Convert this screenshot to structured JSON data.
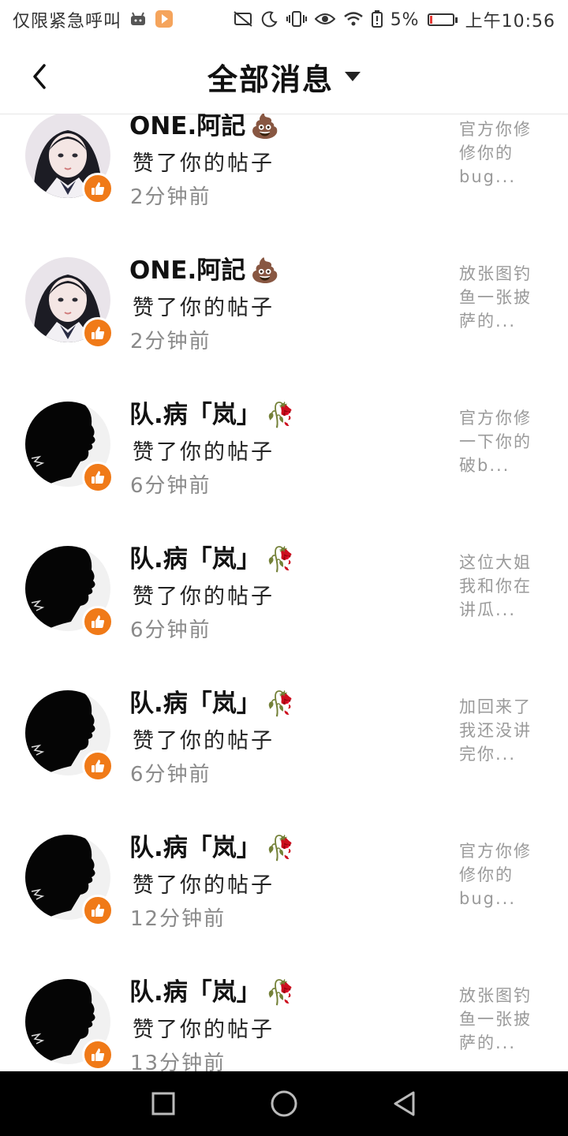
{
  "status_bar": {
    "left_text": "仅限紧急呼叫",
    "battery": "5%",
    "time": "上午10:56",
    "icons": [
      "android-debug-icon",
      "video-app-icon",
      "no-sim-icon",
      "moon-icon",
      "vibrate-icon",
      "eye-icon",
      "wifi-icon",
      "battery-saver-icon",
      "battery-icon"
    ]
  },
  "header": {
    "title": "全部消息",
    "back_icon": "chevron-left-icon",
    "dropdown_icon": "caret-down-icon"
  },
  "notifications": [
    {
      "name": "ONE.阿記",
      "emoji": "💩",
      "action": "赞了你的帖子",
      "time": "2分钟前",
      "preview": "官方你修修你的bug...",
      "avatar": "girl"
    },
    {
      "name": "ONE.阿記",
      "emoji": "💩",
      "action": "赞了你的帖子",
      "time": "2分钟前",
      "preview": "放张图钓鱼一张披萨的...",
      "avatar": "girl"
    },
    {
      "name": "队.病「岚」",
      "emoji": "🥀",
      "action": "赞了你的帖子",
      "time": "6分钟前",
      "preview": "官方你修一下你的破b...",
      "avatar": "silhouette"
    },
    {
      "name": "队.病「岚」",
      "emoji": "🥀",
      "action": "赞了你的帖子",
      "time": "6分钟前",
      "preview": "这位大姐我和你在讲瓜...",
      "avatar": "silhouette"
    },
    {
      "name": "队.病「岚」",
      "emoji": "🥀",
      "action": "赞了你的帖子",
      "time": "6分钟前",
      "preview": "加回来了我还没讲完你...",
      "avatar": "silhouette"
    },
    {
      "name": "队.病「岚」",
      "emoji": "🥀",
      "action": "赞了你的帖子",
      "time": "12分钟前",
      "preview": "官方你修修你的bug...",
      "avatar": "silhouette"
    },
    {
      "name": "队.病「岚」",
      "emoji": "🥀",
      "action": "赞了你的帖子",
      "time": "13分钟前",
      "preview": "放张图钓鱼一张披萨的...",
      "avatar": "silhouette"
    }
  ],
  "nav_bar": {
    "buttons": [
      "recents-square-icon",
      "home-circle-icon",
      "back-triangle-icon"
    ]
  },
  "colors": {
    "like_badge": "#f07a18",
    "secondary_text": "#8a8a8a",
    "preview_text": "#9a9a9a",
    "nav_background": "#000000"
  }
}
